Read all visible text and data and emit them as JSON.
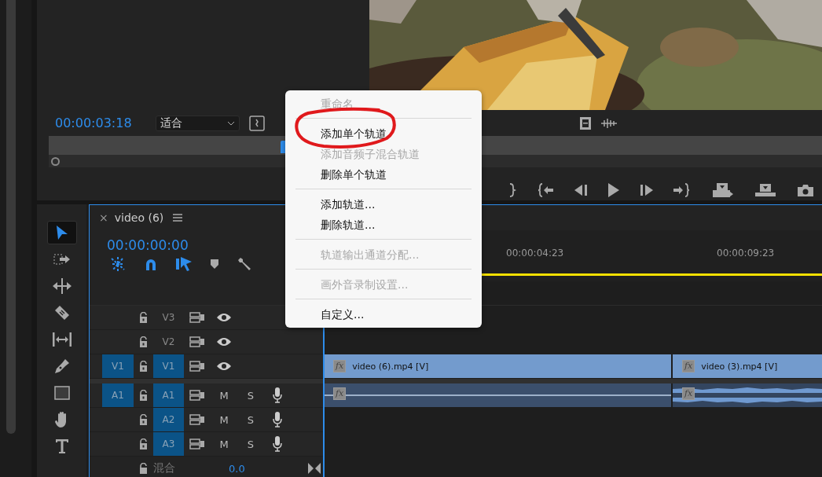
{
  "source_monitor": {
    "timecode": "00:00:03:18",
    "zoom": "适合",
    "scrubber": {
      "level": 0.3
    }
  },
  "tools": [
    {
      "kind": "selection",
      "selected": true
    },
    {
      "kind": "track-select",
      "selected": false
    },
    {
      "kind": "ripple",
      "selected": false
    },
    {
      "kind": "razor",
      "selected": false
    },
    {
      "kind": "slip",
      "selected": false
    },
    {
      "kind": "pen",
      "selected": false
    },
    {
      "kind": "rectangle",
      "selected": false
    },
    {
      "kind": "hand",
      "selected": false
    },
    {
      "kind": "type",
      "selected": false
    }
  ],
  "timeline": {
    "close": "×",
    "title": "video (6)",
    "timecode": "00:00:00:00",
    "toolbar": [
      {
        "kind": "nest",
        "on": true
      },
      {
        "kind": "snap",
        "on": true
      },
      {
        "kind": "linked",
        "on": true
      },
      {
        "kind": "marker",
        "on": false
      },
      {
        "kind": "settings",
        "on": false
      }
    ],
    "ruler": [
      "00:00:04:23",
      "00:00:09:23"
    ],
    "tracks": [
      {
        "kind": "video",
        "label": "V3",
        "targeted": false
      },
      {
        "kind": "video",
        "label": "V2",
        "targeted": false
      },
      {
        "kind": "video",
        "source": "V1",
        "label": "V1",
        "targeted": true,
        "clips": [
          {
            "name": "video (6).mp4 [V]",
            "badge": "fx"
          },
          {
            "name": "video (3).mp4 [V]",
            "badge": "fx"
          }
        ]
      },
      {
        "kind": "audio",
        "source": "A1",
        "label": "A1",
        "targeted": true,
        "mute": "M",
        "solo": "S",
        "clips": [
          {
            "badge": "fx",
            "waveform": false
          },
          {
            "badge": "fx",
            "waveform": true
          }
        ]
      },
      {
        "kind": "audio",
        "label": "A2",
        "targeted": true,
        "mute": "M",
        "solo": "S"
      },
      {
        "kind": "audio",
        "label": "A3",
        "targeted": true,
        "mute": "M",
        "solo": "S"
      }
    ],
    "mix": {
      "label": "混合",
      "value": "0.0"
    }
  },
  "context_menu": [
    {
      "kind": "item",
      "label": "重命名",
      "disabled": true
    },
    {
      "kind": "separator"
    },
    {
      "kind": "item",
      "label": "添加单个轨道",
      "disabled": false
    },
    {
      "kind": "item",
      "label": "添加音频子混合轨道",
      "disabled": true
    },
    {
      "kind": "item",
      "label": "删除单个轨道",
      "disabled": false
    },
    {
      "kind": "separator"
    },
    {
      "kind": "item",
      "label": "添加轨道...",
      "disabled": false
    },
    {
      "kind": "item",
      "label": "删除轨道...",
      "disabled": false
    },
    {
      "kind": "separator"
    },
    {
      "kind": "item",
      "label": "轨道输出通道分配...",
      "disabled": true
    },
    {
      "kind": "separator"
    },
    {
      "kind": "item",
      "label": "画外音录制设置...",
      "disabled": true
    },
    {
      "kind": "separator"
    },
    {
      "kind": "item",
      "label": "自定义...",
      "disabled": false
    }
  ]
}
